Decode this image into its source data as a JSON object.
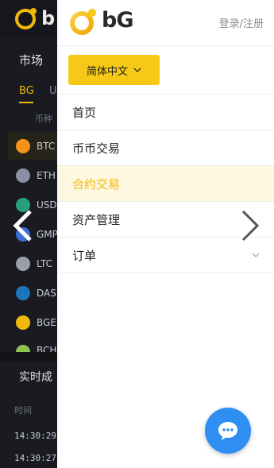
{
  "background": {
    "title": "市场",
    "tabs": [
      "BG",
      "U"
    ],
    "column_header": "币种",
    "coins": [
      {
        "label": "BTC",
        "color": "#f7931a"
      },
      {
        "label": "ETH",
        "color": "#8a8fa3"
      },
      {
        "label": "USD",
        "color": "#26a17b"
      },
      {
        "label": "GMP",
        "color": "#3b6fd4"
      },
      {
        "label": "LTC",
        "color": "#9aa0a8"
      },
      {
        "label": "DAS",
        "color": "#1c75bc"
      },
      {
        "label": "BGE",
        "color": "#f0b90b"
      },
      {
        "label": "BCH",
        "color": "#8dc351"
      }
    ],
    "section_title": "实时成",
    "time_header": "时间",
    "times": [
      "14:30:29",
      "14:30:27"
    ]
  },
  "drawer": {
    "logo_text": "bG",
    "login": "登录",
    "auth_separator": " / ",
    "register": "注册",
    "language": "简体中文",
    "menu": [
      {
        "label": "首页",
        "active": false
      },
      {
        "label": "币币交易",
        "active": false
      },
      {
        "label": "合约交易",
        "active": true
      },
      {
        "label": "资产管理",
        "active": false
      },
      {
        "label": "订单",
        "active": false,
        "expandable": true
      }
    ]
  },
  "colors": {
    "accent": "#f6c818",
    "active_text": "#f0b90b",
    "active_bg": "#fef8e0",
    "chat": "#2f8ef2"
  },
  "icons": [
    "bg-logo-icon",
    "chevron-down-icon",
    "chevron-left-icon",
    "chevron-right-icon",
    "chat-icon"
  ]
}
